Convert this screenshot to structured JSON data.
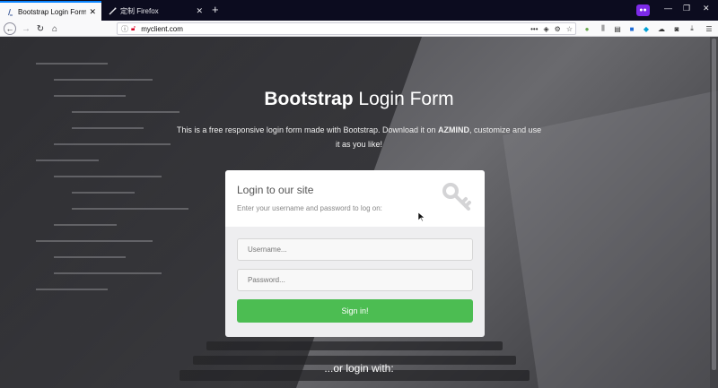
{
  "browser": {
    "tabs": [
      {
        "title": "Bootstrap Login Form Temp",
        "active": true
      },
      {
        "title": "定制 Firefox",
        "active": false
      }
    ],
    "new_tab_icon": "plus-icon",
    "url": "myclient.com"
  },
  "hero": {
    "title_bold": "Bootstrap",
    "title_light": "Login Form",
    "description_prefix": "This is a free responsive login form made with Bootstrap. Download it on",
    "description_brand": "AZMIND",
    "description_suffix": ", customize and use it as you like!"
  },
  "login": {
    "heading": "Login to our site",
    "subtext": "Enter your username and password to log on:",
    "username_placeholder": "Username...",
    "password_placeholder": "Password...",
    "submit_label": "Sign in!",
    "button_color": "#4cbd52"
  },
  "footer": {
    "alt_login": "...or login with:"
  }
}
